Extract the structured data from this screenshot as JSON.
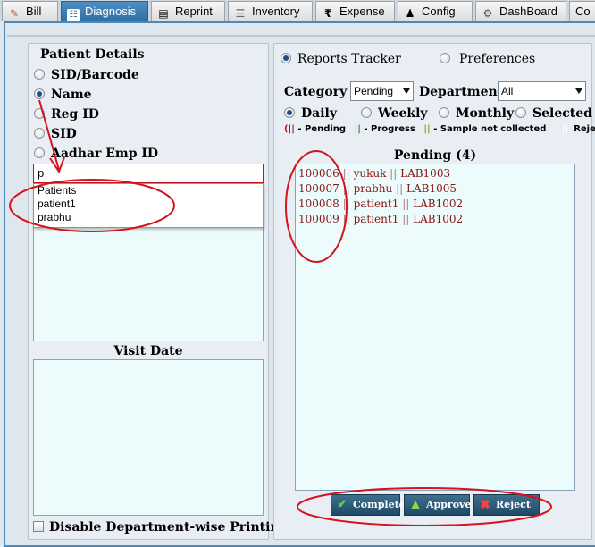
{
  "tabs": [
    {
      "label": "Bill",
      "icon": "bill-icon"
    },
    {
      "label": "Diagnosis",
      "icon": "diagnosis-icon",
      "active": true
    },
    {
      "label": "Reprint",
      "icon": "reprint-icon"
    },
    {
      "label": "Inventory",
      "icon": "inventory-icon"
    },
    {
      "label": "Expense",
      "icon": "rupee-icon"
    },
    {
      "label": "Config",
      "icon": "user-icon"
    },
    {
      "label": "DashBoard",
      "icon": "dashboard-icon"
    },
    {
      "label": "Co",
      "icon": ""
    }
  ],
  "patient_details": {
    "title": "Patient Details",
    "search_options": [
      {
        "label": "SID/Barcode",
        "checked": false
      },
      {
        "label": "Name",
        "checked": true
      },
      {
        "label": "Reg ID",
        "checked": false
      },
      {
        "label": "SID",
        "checked": false
      },
      {
        "label": "Aadhar Emp ID",
        "checked": false
      }
    ],
    "search_value": "p",
    "suggestions": [
      "Patients",
      "patient1",
      "prabhu"
    ],
    "visit_date_title": "Visit Date",
    "disable_printing_label": "Disable Department-wise Printing"
  },
  "right": {
    "modes": [
      {
        "label": "Reports Tracker",
        "checked": true
      },
      {
        "label": "Preferences",
        "checked": false
      }
    ],
    "category_label": "Category",
    "category_value": "Pending",
    "department_label": "Department",
    "department_value": "All",
    "periods": [
      {
        "label": "Daily",
        "checked": true
      },
      {
        "label": "Weekly",
        "checked": false
      },
      {
        "label": "Monthly",
        "checked": false
      },
      {
        "label": "Selected",
        "checked": false
      }
    ],
    "legend": {
      "pending_mark": "(||",
      "pending_text": " - Pending",
      "progress_mark": "||",
      "progress_text": " - Progress",
      "sample_mark": "||",
      "sample_text": " - Sample not collected",
      "rejected_mark": "||",
      "rejected_text": "Rejected)"
    },
    "pending_title": "Pending (4)",
    "pending_items": [
      {
        "sid": "100006",
        "name": "yukuk",
        "lab": "LAB1003"
      },
      {
        "sid": "100007",
        "name": "prabhu",
        "lab": "LAB1005"
      },
      {
        "sid": "100008",
        "name": "patient1",
        "lab": "LAB1002"
      },
      {
        "sid": "100009",
        "name": "patient1",
        "lab": "LAB1002"
      }
    ],
    "buttons": {
      "complete": "Complete",
      "approve": "Approve",
      "reject": "Reject"
    }
  },
  "colors": {
    "annotation": "#d4141c",
    "active_tab": "#2e6fa4",
    "pending_text": "#8a1313"
  }
}
